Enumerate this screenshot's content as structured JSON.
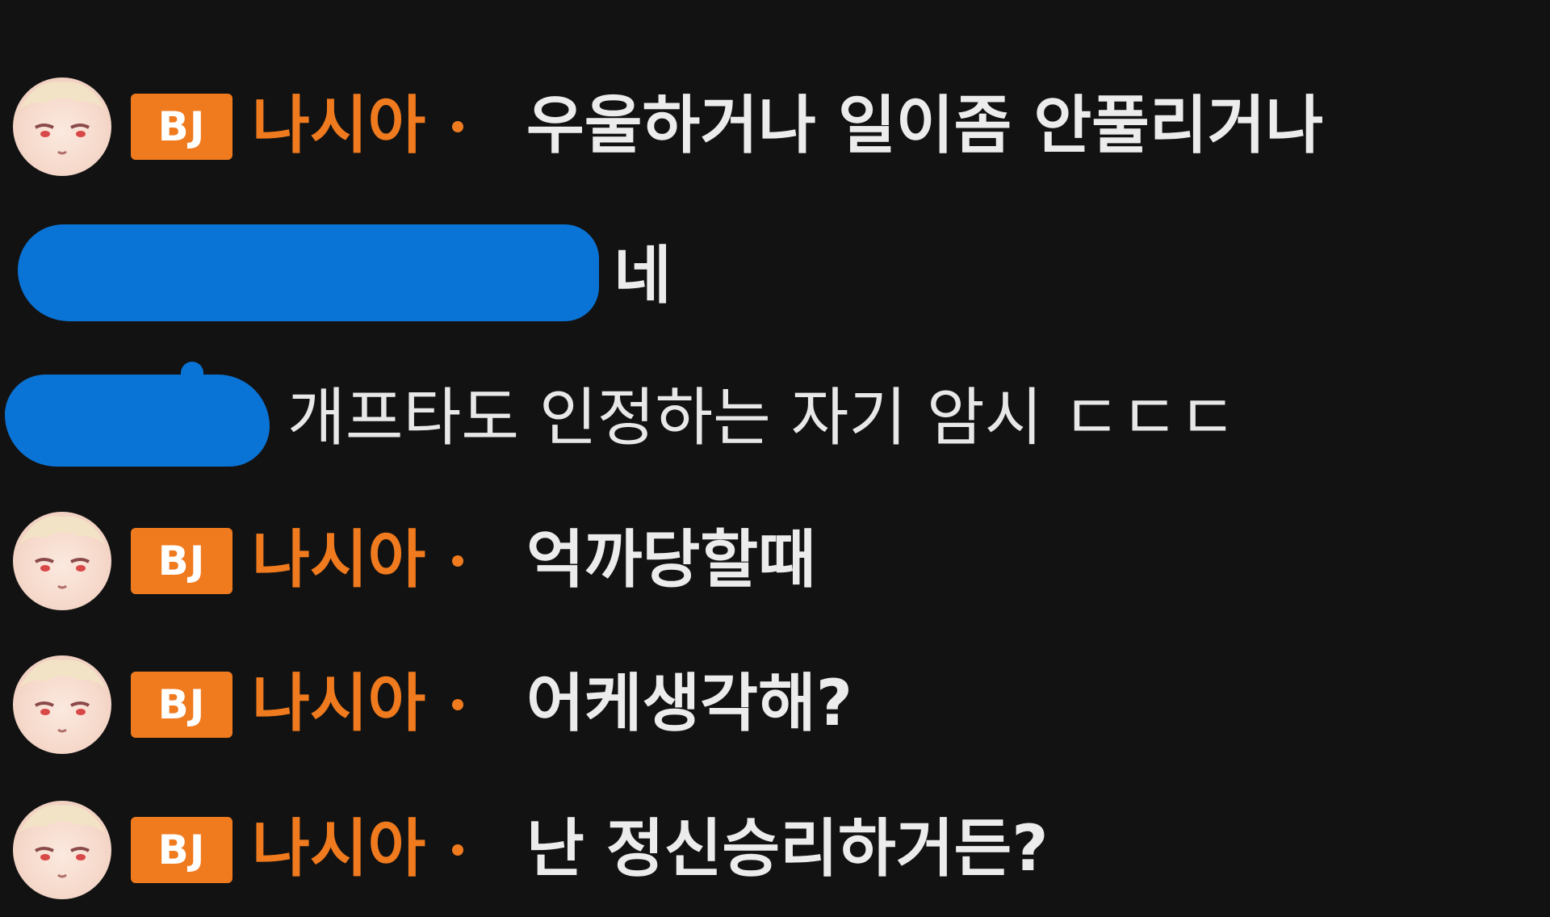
{
  "chat": {
    "messages": [
      {
        "id": "m1",
        "avatar_icon": "anime-avatar-icon",
        "badge": "BJ",
        "nickname": "나시아",
        "text": "우울하거나 일이좀 안풀리거나"
      },
      {
        "id": "m2",
        "redacted_user": true,
        "text": "네"
      },
      {
        "id": "m3",
        "redacted_user": true,
        "text": "개프타도 인정하는 자기 암시 ㄷㄷㄷ"
      },
      {
        "id": "m4",
        "avatar_icon": "anime-avatar-icon",
        "badge": "BJ",
        "nickname": "나시아",
        "text": "억까당할때"
      },
      {
        "id": "m5",
        "avatar_icon": "anime-avatar-icon",
        "badge": "BJ",
        "nickname": "나시아",
        "text": "어케생각해?"
      },
      {
        "id": "m6",
        "avatar_icon": "anime-avatar-icon",
        "badge": "BJ",
        "nickname": "나시아",
        "text": "난 정신승리하거든?"
      }
    ]
  },
  "colors": {
    "background": "#121212",
    "accent": "#f07a1e",
    "text": "#ececec",
    "redaction": "#0a74d6"
  }
}
